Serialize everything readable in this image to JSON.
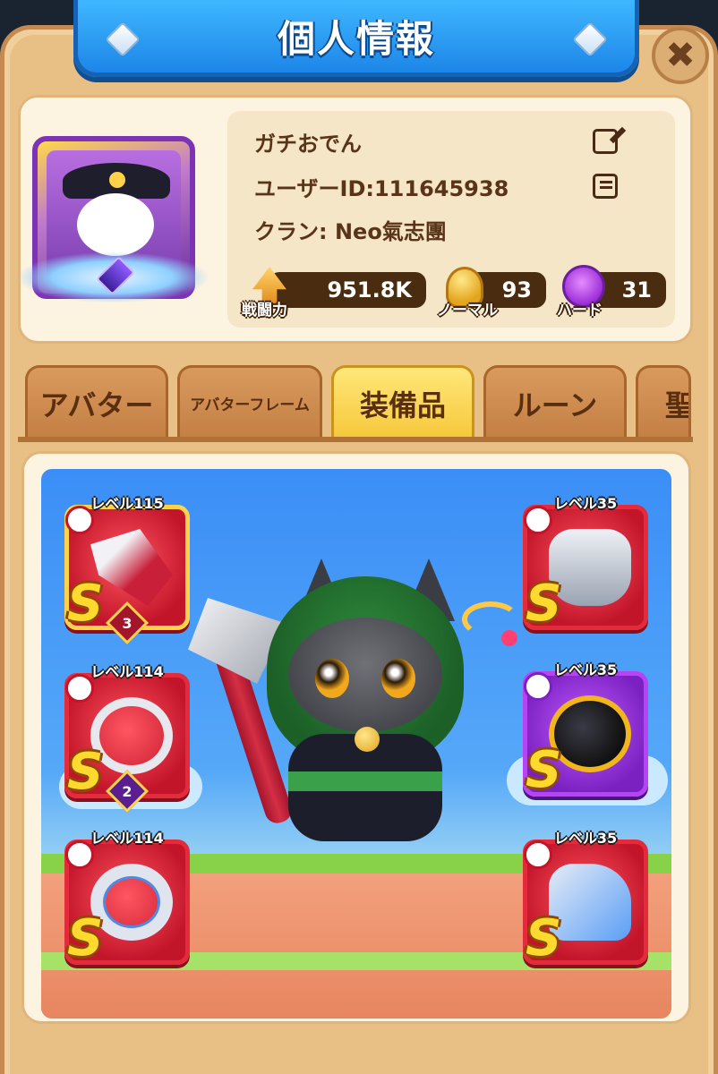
{
  "header": {
    "title": "個人情報"
  },
  "profile": {
    "name": "ガチおでん",
    "user_id": "ユーザーID:111645938",
    "clan": "クラン: Neo氣志團",
    "stats": {
      "power": {
        "value": "951.8K",
        "label": "戦闘力"
      },
      "normal": {
        "value": "93",
        "label": "ノーマル"
      },
      "hard": {
        "value": "31",
        "label": "ハード"
      }
    }
  },
  "tabs": [
    {
      "label": "アバター",
      "active": false
    },
    {
      "label": "アバターフレーム",
      "active": false
    },
    {
      "label": "装備品",
      "active": true
    },
    {
      "label": "ルーン",
      "active": false
    },
    {
      "label": "聖",
      "active": false
    }
  ],
  "equipment": {
    "slots": [
      {
        "slot": "weapon",
        "level": "レベル115",
        "rank": "S",
        "stars": "3",
        "icon": "crossbow-icon"
      },
      {
        "slot": "necklace",
        "level": "レベル114",
        "rank": "S",
        "stars": "2",
        "icon": "necklace-icon"
      },
      {
        "slot": "ring",
        "level": "レベル114",
        "rank": "S",
        "stars": "",
        "icon": "ring-icon"
      },
      {
        "slot": "armor",
        "level": "レベル35",
        "rank": "S",
        "stars": "",
        "icon": "armor-icon"
      },
      {
        "slot": "helmet",
        "level": "レベル35",
        "rank": "S",
        "stars": "",
        "icon": "helmet-icon"
      },
      {
        "slot": "boots",
        "level": "レベル35",
        "rank": "S",
        "stars": "",
        "icon": "boots-icon"
      }
    ]
  },
  "colors": {
    "banner": "#1d86e8",
    "active_tab": "#f6c83a",
    "slot_red": "#e32b3c",
    "slot_purple": "#b843f5"
  }
}
